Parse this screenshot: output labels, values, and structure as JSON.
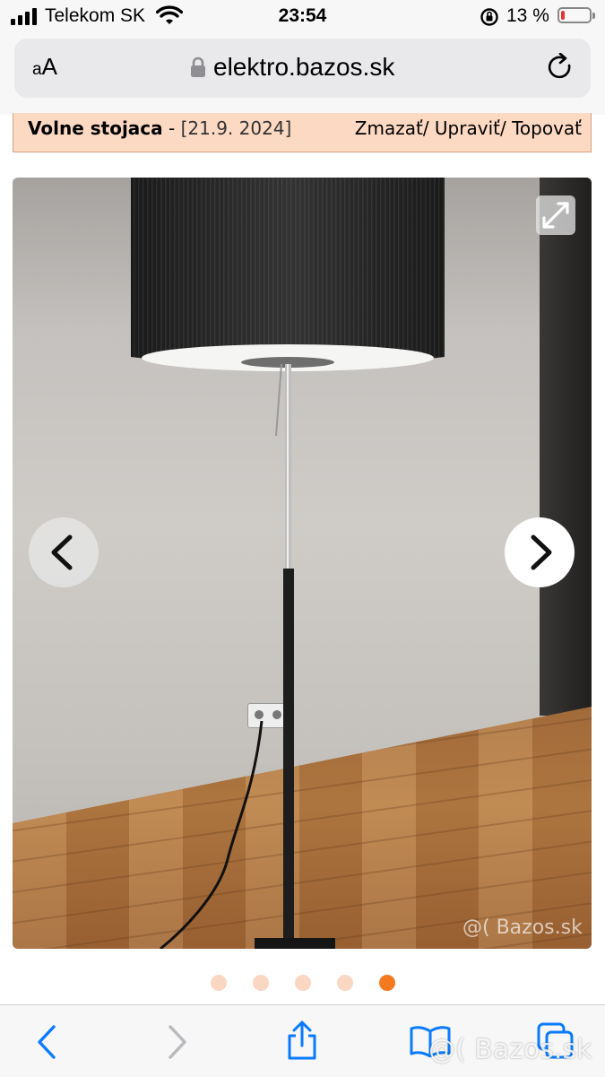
{
  "status_bar": {
    "carrier": "Telekom SK",
    "time": "23:54",
    "battery_percent": "13 %",
    "battery_level": 0.13,
    "battery_color": "#e5352d"
  },
  "browser": {
    "reader_label_small": "A",
    "reader_label_large": "A",
    "url": "elektro.bazos.sk",
    "icons": [
      "lock-icon",
      "reload-icon"
    ]
  },
  "listing": {
    "title": "Volne stojaca",
    "separator": " - ",
    "date": "[21.9. 2024]",
    "actions": [
      "Zmazať",
      "Upraviť",
      "Topovať"
    ],
    "header_bg": "#fcd9c3"
  },
  "gallery": {
    "watermark": "@( Bazos.sk",
    "image_count": 5,
    "active_index": 4,
    "dot_color": "#f9d7c3",
    "active_dot_color": "#f47a20",
    "icons": [
      "expand-icon",
      "chevron-left-icon",
      "chevron-right-icon"
    ]
  },
  "toolbar": {
    "icons": [
      "back-icon",
      "forward-icon",
      "share-icon",
      "bookmarks-icon",
      "tabs-icon"
    ],
    "watermark": "@( Bazos.sk",
    "accent": "#0a7aff"
  }
}
